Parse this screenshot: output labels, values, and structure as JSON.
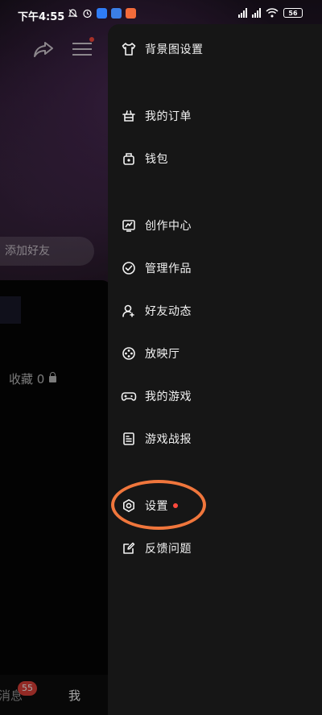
{
  "status_bar": {
    "time": "下午4:55",
    "battery": "56"
  },
  "background": {
    "add_friend": "添加好友",
    "collect_label": "收藏 0",
    "tab_messages": "消息",
    "tab_messages_badge": "55",
    "tab_me": "我"
  },
  "drawer": {
    "items": [
      {
        "label": "背景图设置",
        "icon": "shirt-icon"
      },
      {
        "label": "我的订单",
        "icon": "basket-icon"
      },
      {
        "label": "钱包",
        "icon": "wallet-icon"
      },
      {
        "label": "创作中心",
        "icon": "creator-icon"
      },
      {
        "label": "管理作品",
        "icon": "check-circle-icon"
      },
      {
        "label": "好友动态",
        "icon": "friend-icon"
      },
      {
        "label": "放映厅",
        "icon": "film-reel-icon"
      },
      {
        "label": "我的游戏",
        "icon": "gamepad-icon"
      },
      {
        "label": "游戏战报",
        "icon": "report-icon"
      },
      {
        "label": "设置",
        "icon": "settings-icon",
        "has_dot": true
      },
      {
        "label": "反馈问题",
        "icon": "edit-icon"
      }
    ]
  },
  "colors": {
    "drawer_bg": "#161616",
    "highlight_ring": "#f0763c",
    "red_dot": "#ff4a3d",
    "badge": "#e0413a"
  }
}
